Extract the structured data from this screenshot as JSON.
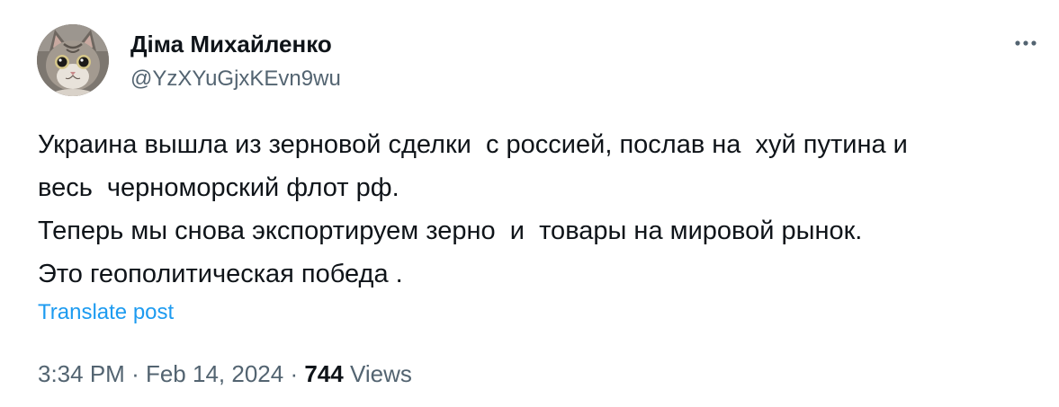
{
  "author": {
    "display_name": "Діма Михайленко",
    "handle": "@YzXYuGjxKEvn9wu",
    "avatar_icon": "cat-avatar-icon"
  },
  "menu": {
    "more_icon": "more-horizontal-icon"
  },
  "tweet": {
    "text_lines": [
      "Украина вышла из зерновой сделки  с россией, послав на  хуй путина и",
      "весь  черноморский флот рф.",
      "Теперь мы снова экспортируем зерно  и  товары на мировой рынок.",
      "Это геополитическая победа ."
    ],
    "translate_label": "Translate post"
  },
  "meta": {
    "time": "3:34 PM",
    "separator": "·",
    "date": "Feb 14, 2024",
    "views_count": "744",
    "views_label": "Views"
  },
  "colors": {
    "text_primary": "#0f1419",
    "text_secondary": "#536471",
    "link": "#1d9bf0"
  }
}
